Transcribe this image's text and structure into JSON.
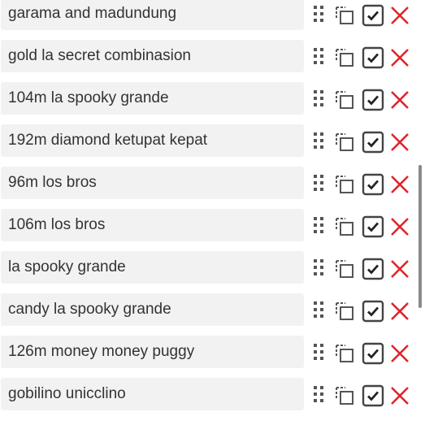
{
  "entries": [
    {
      "text": "garama and madundung"
    },
    {
      "text": "gold la secret combinasion"
    },
    {
      "text": "104m la spooky grande"
    },
    {
      "text": "192m diamond ketupat kepat"
    },
    {
      "text": "96m los bros"
    },
    {
      "text": "106m los bros"
    },
    {
      "text": "la spooky grande"
    },
    {
      "text": "candy la spooky grande"
    },
    {
      "text": "126m money money puggy"
    },
    {
      "text": "gobilino unicclino"
    }
  ],
  "icons": {
    "drag": "drag-handle-icon",
    "copy": "copy-icon",
    "confirm": "checkbox-check-icon",
    "delete": "delete-x-icon"
  },
  "colors": {
    "field_bg": "#f2f2f2",
    "text": "#333333",
    "icon": "#444444",
    "delete": "#e0242c"
  }
}
